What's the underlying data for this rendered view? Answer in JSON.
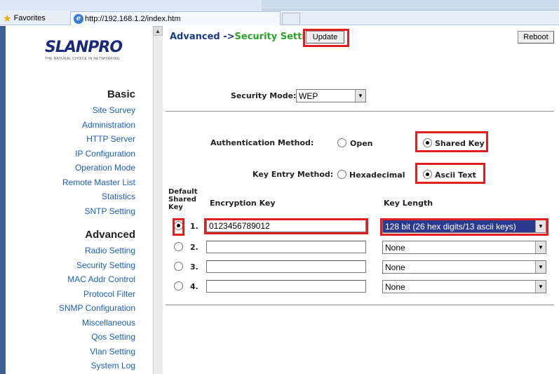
{
  "browser": {
    "favorites_label": "Favorites",
    "tab_url": "http://192.168.1.2/index.htm"
  },
  "logo": {
    "name": "SLANPRO",
    "tagline": "THE NATURAL CHOICE IN NETWORKING"
  },
  "sidebar": {
    "basic_heading": "Basic",
    "basic_items": [
      "Site Survey",
      "Administration",
      "HTTP Server",
      "IP Configuration",
      "Operation Mode",
      "Remote Master List",
      "Statistics",
      "SNTP Setting"
    ],
    "advanced_heading": "Advanced",
    "advanced_items": [
      "Radio Setting",
      "Security Setting",
      "MAC Addr Control",
      "Protocol Filter",
      "SNMP Configuration",
      "Miscellaneous",
      "Qos Setting",
      "Vlan Setting",
      "System Log"
    ]
  },
  "main": {
    "breadcrumb_prefix": "Advanced ->",
    "breadcrumb_page": "Security Setting",
    "update_label": "Update",
    "reboot_label": "Reboot",
    "security_mode_label": "Security Mode:",
    "security_mode_value": "WEP",
    "auth_method_label": "Authentication Method:",
    "auth_open_label": "Open",
    "auth_shared_label": "Shared Key",
    "key_entry_label": "Key Entry Method:",
    "key_hex_label": "Hexadecimal",
    "key_ascii_label": "Ascii Text",
    "col_default_shared_key": [
      "Default",
      "Shared",
      "Key"
    ],
    "col_encryption_key": "Encryption Key",
    "col_key_length": "Key Length",
    "keys": [
      {
        "num": "1.",
        "value": "0123456789012",
        "length": "128 bit (26 hex digits/13 ascii keys)"
      },
      {
        "num": "2.",
        "value": "",
        "length": "None"
      },
      {
        "num": "3.",
        "value": "",
        "length": "None"
      },
      {
        "num": "4.",
        "value": "",
        "length": "None"
      }
    ]
  },
  "colors": {
    "highlight": "#e02020",
    "link": "#1a5fb4",
    "title": "#1a3c8a",
    "title_page": "#29a329"
  }
}
